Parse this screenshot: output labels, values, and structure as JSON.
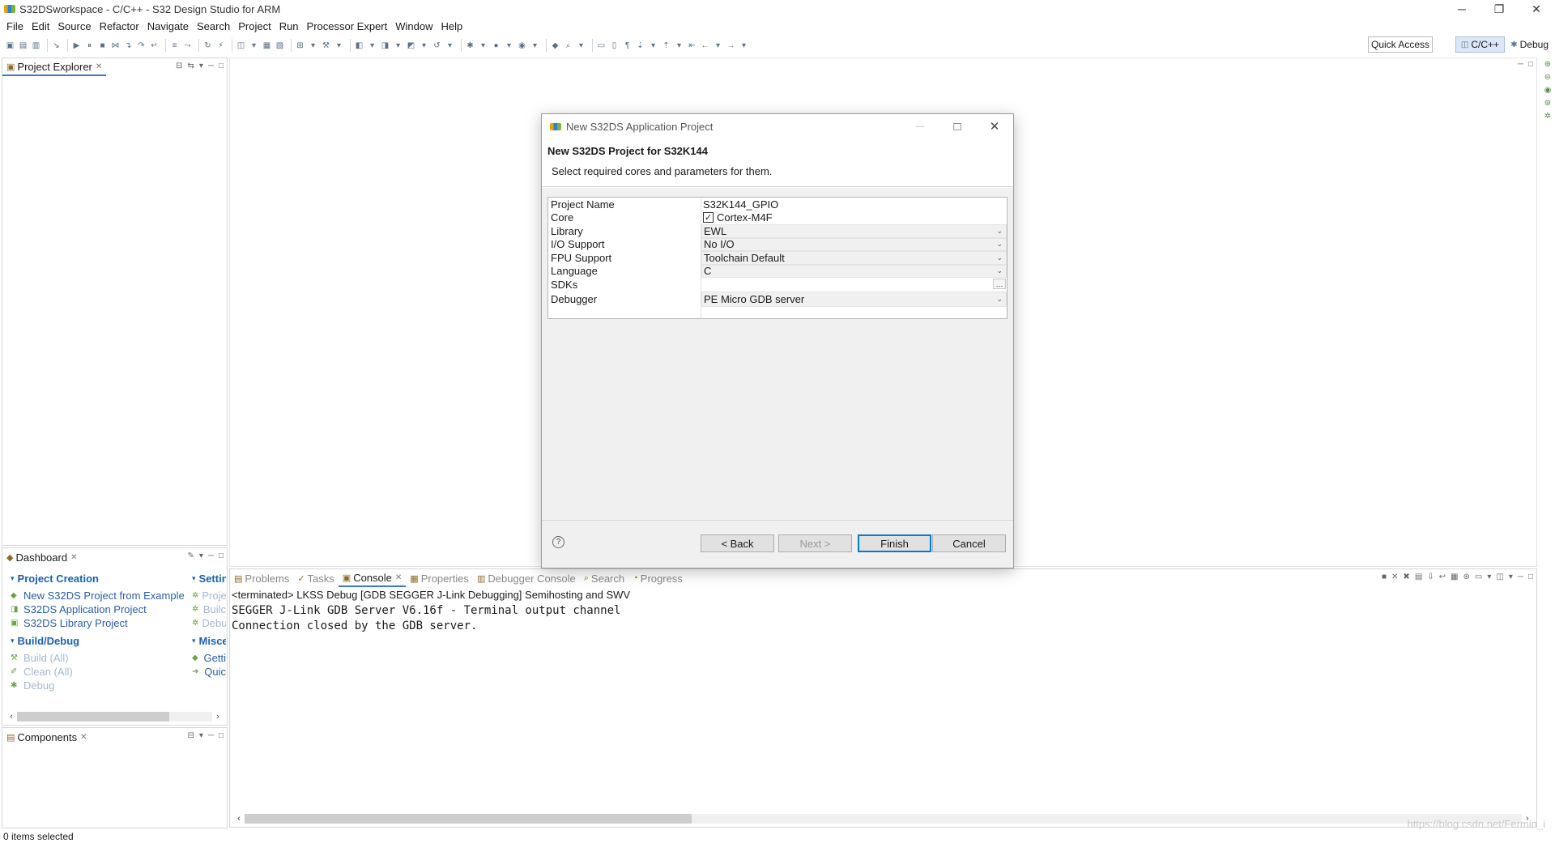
{
  "window": {
    "title": "S32DSworkspace - C/C++ - S32 Design Studio for ARM",
    "controls": {
      "minimize": "─",
      "restore": "❐",
      "close": "✕"
    }
  },
  "menu": [
    "File",
    "Edit",
    "Source",
    "Refactor",
    "Navigate",
    "Search",
    "Project",
    "Run",
    "Processor Expert",
    "Window",
    "Help"
  ],
  "toolbar": {
    "quick_access": "Quick Access",
    "perspectives": {
      "cpp": "C/C++",
      "debug": "Debug"
    }
  },
  "project_explorer": {
    "tab": "Project Explorer"
  },
  "dashboard": {
    "tab": "Dashboard",
    "project_creation": {
      "heading": "Project Creation",
      "items": [
        "New S32DS Project from Example",
        "S32DS Application Project",
        "S32DS Library Project"
      ]
    },
    "build_debug": {
      "heading": "Build/Debug",
      "items": [
        "Build  (All)",
        "Clean  (All)",
        "Debug"
      ]
    },
    "settings": {
      "heading": "Settin",
      "items": [
        "Proje",
        "Builc",
        "Debu"
      ]
    },
    "misc": {
      "heading": "Misce",
      "items": [
        "Getti",
        "Quic"
      ]
    }
  },
  "components": {
    "tab": "Components"
  },
  "console_panel": {
    "tabs": [
      "Problems",
      "Tasks",
      "Console",
      "Properties",
      "Debugger Console",
      "Search",
      "Progress"
    ],
    "header": "<terminated> LKSS Debug [GDB SEGGER J-Link Debugging] Semihosting and SWV",
    "lines": [
      "SEGGER J-Link GDB Server V6.16f - Terminal output channel",
      "Connection closed by the GDB server."
    ]
  },
  "status": {
    "selection": "0 items selected"
  },
  "watermark": "https://blog.csdn.net/Fermin_i",
  "dialog": {
    "title": "New S32DS Application Project",
    "banner_title": "New S32DS Project for S32K144",
    "banner_desc": "Select required cores and parameters for them.",
    "rows": {
      "project_name": {
        "label": "Project Name",
        "value": "S32K144_GPIO"
      },
      "core": {
        "label": "Core",
        "value": "Cortex-M4F",
        "checked": true
      },
      "library": {
        "label": "Library",
        "value": "EWL"
      },
      "io_support": {
        "label": "I/O Support",
        "value": "No I/O"
      },
      "fpu_support": {
        "label": "FPU Support",
        "value": "Toolchain Default"
      },
      "language": {
        "label": "Language",
        "value": "C"
      },
      "sdks": {
        "label": "SDKs",
        "value": ""
      },
      "debugger": {
        "label": "Debugger",
        "value": "PE Micro GDB server"
      }
    },
    "buttons": {
      "help": "?",
      "back": "< Back",
      "next": "Next >",
      "finish": "Finish",
      "cancel": "Cancel"
    }
  }
}
